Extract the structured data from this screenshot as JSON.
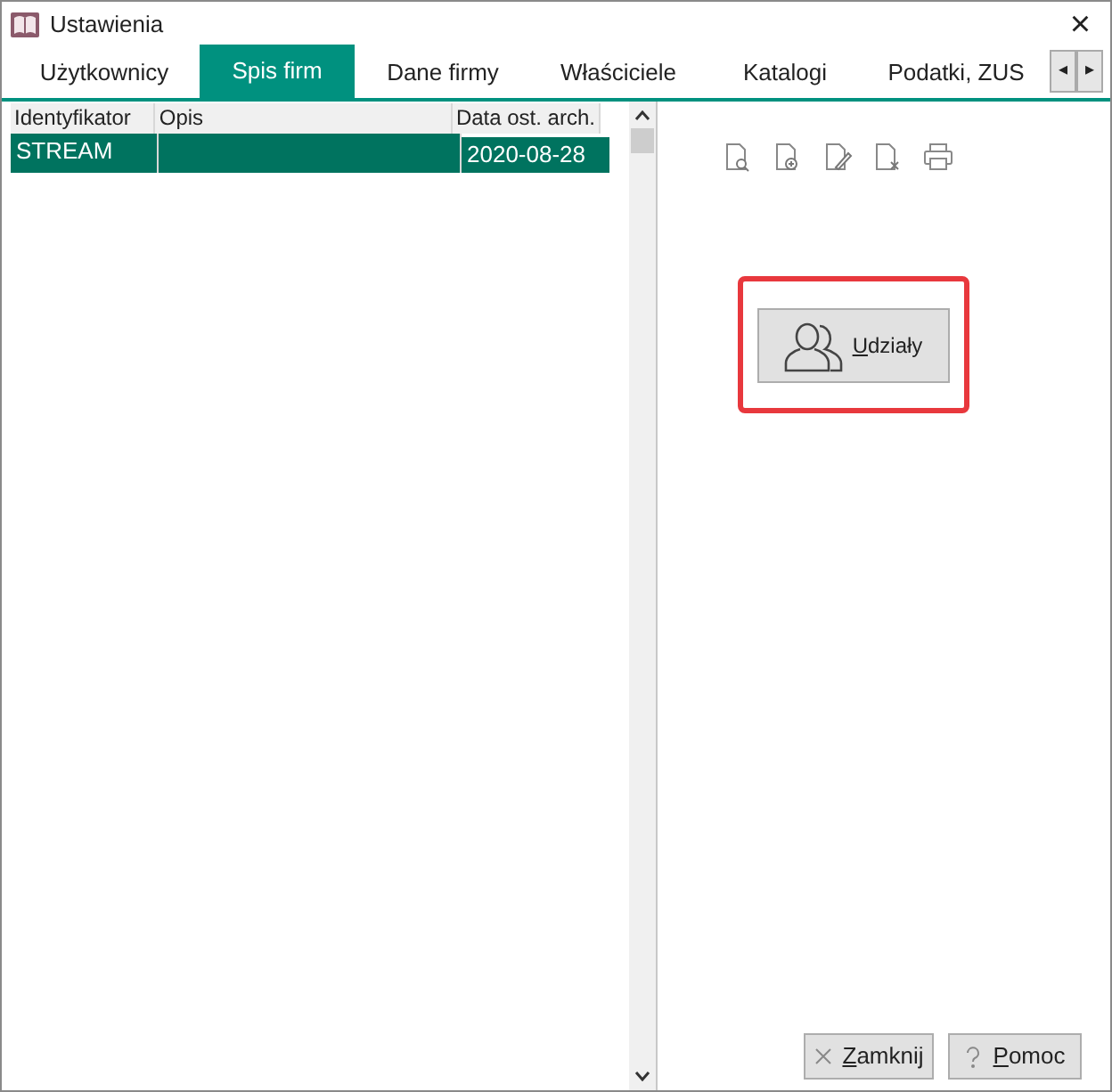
{
  "window": {
    "title": "Ustawienia",
    "close": "×"
  },
  "tabs": [
    {
      "label": "Użytkownicy",
      "selected": false
    },
    {
      "label": "Spis firm",
      "selected": true
    },
    {
      "label": "Dane firmy",
      "selected": false
    },
    {
      "label": "Właściciele",
      "selected": false
    },
    {
      "label": "Katalogi",
      "selected": false
    },
    {
      "label": "Podatki, ZUS",
      "selected": false
    }
  ],
  "tab_scroll": [
    "◂",
    "▸"
  ],
  "table": {
    "columns": [
      "Identyfikator",
      "Opis",
      "Data ost. arch."
    ],
    "rows": [
      {
        "cells": [
          "STREAM",
          "",
          "2020-08-28"
        ],
        "selected": true
      }
    ]
  },
  "toolbar": [
    {
      "kind": "preview"
    },
    {
      "kind": "add"
    },
    {
      "kind": "edit"
    },
    {
      "kind": "delete"
    },
    {
      "kind": "print"
    }
  ],
  "shares_button": {
    "mnemonic": "U",
    "rest": "działy",
    "highlighted": true
  },
  "footer_buttons": [
    {
      "kind": "close",
      "mnemonic": "Z",
      "rest": "amknij"
    },
    {
      "kind": "help",
      "mnemonic": "P",
      "rest": "omoc"
    }
  ]
}
